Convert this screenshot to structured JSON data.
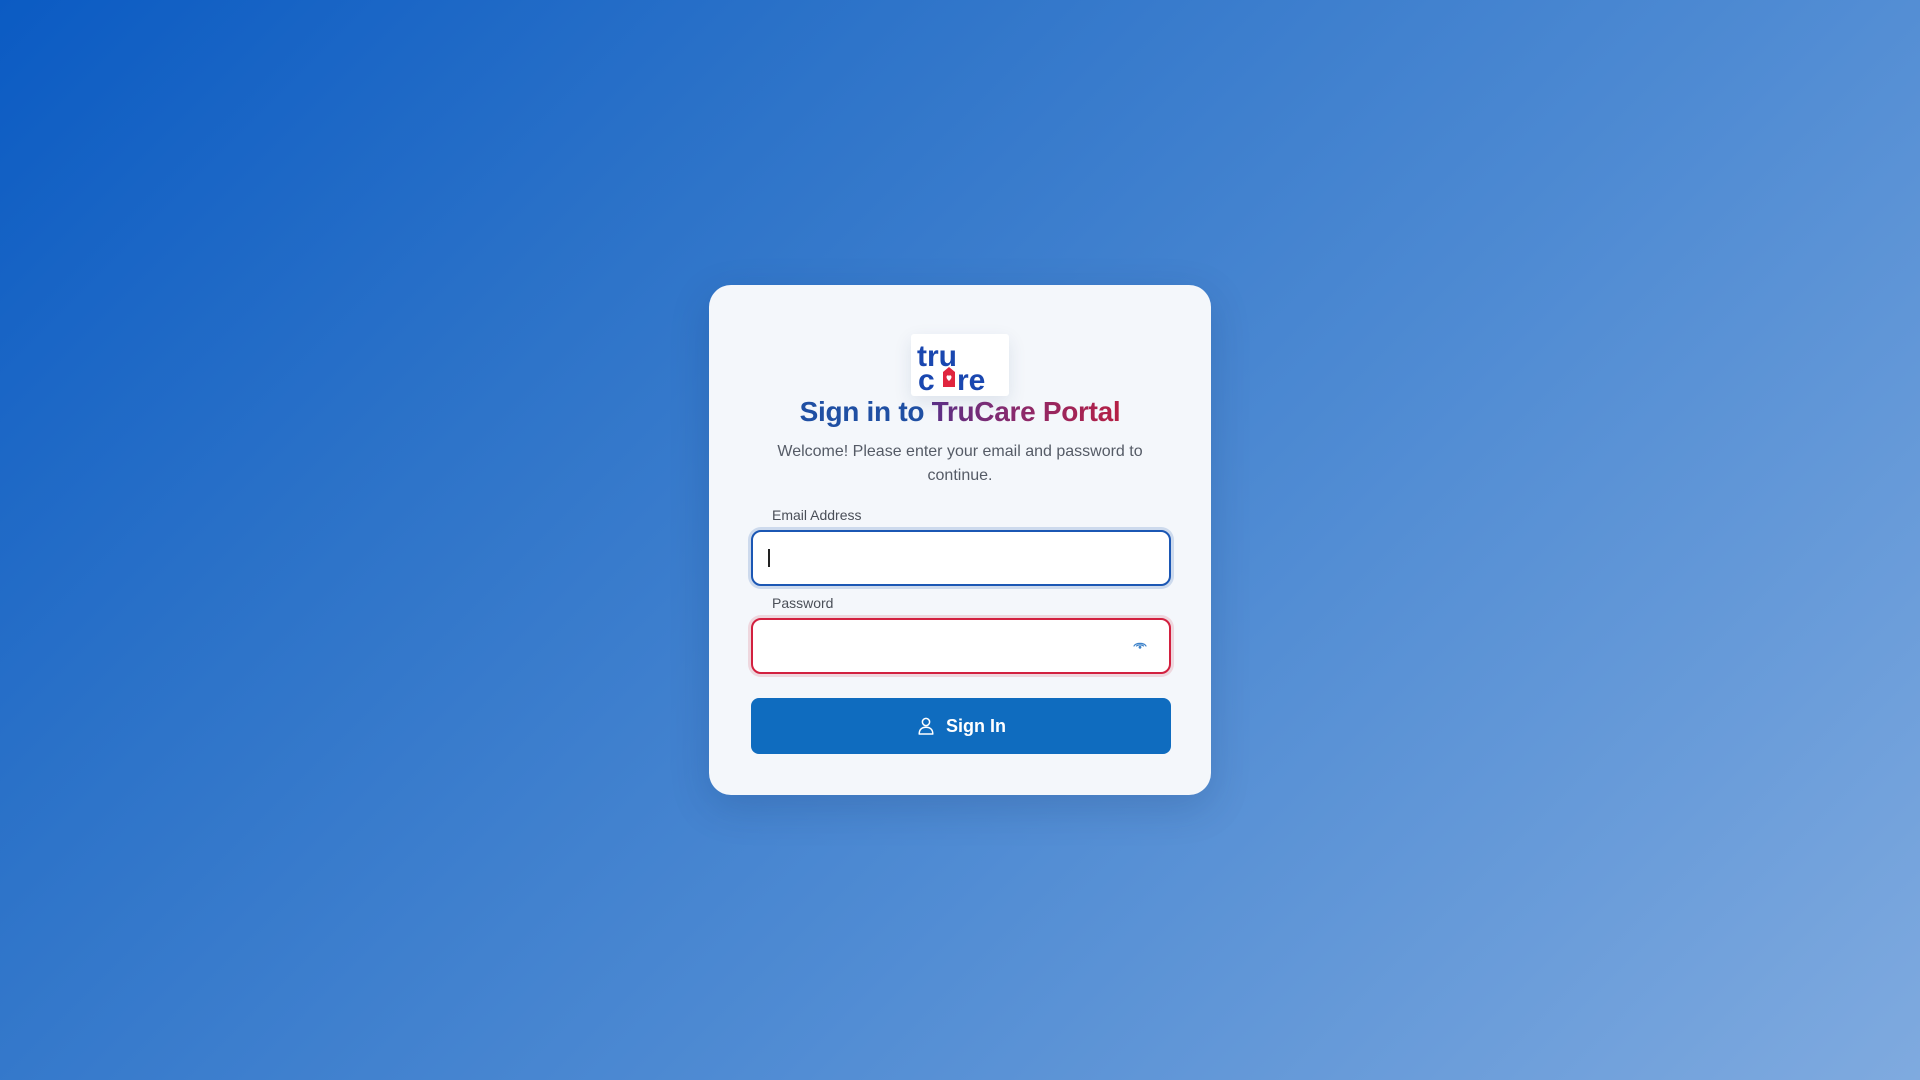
{
  "logo": {
    "text": "truCare",
    "icon": "trucare-logo"
  },
  "title": {
    "part1": "Sign in to ",
    "part2": "TruCare Portal"
  },
  "subtitle": "Welcome! Please enter your email and password to continue.",
  "email": {
    "label": "Email Address",
    "value": "",
    "placeholder": ""
  },
  "password": {
    "label": "Password",
    "value": "",
    "placeholder": "",
    "toggle_icon": "eye-icon"
  },
  "signin_button": {
    "label": "Sign In",
    "icon": "user-icon"
  },
  "colors": {
    "accent": "#0f6cbf",
    "email_border": "#1b57b4",
    "password_border_error": "#d2203f",
    "title_blue": "#1f4fa3",
    "title_red": "#b51f44"
  }
}
